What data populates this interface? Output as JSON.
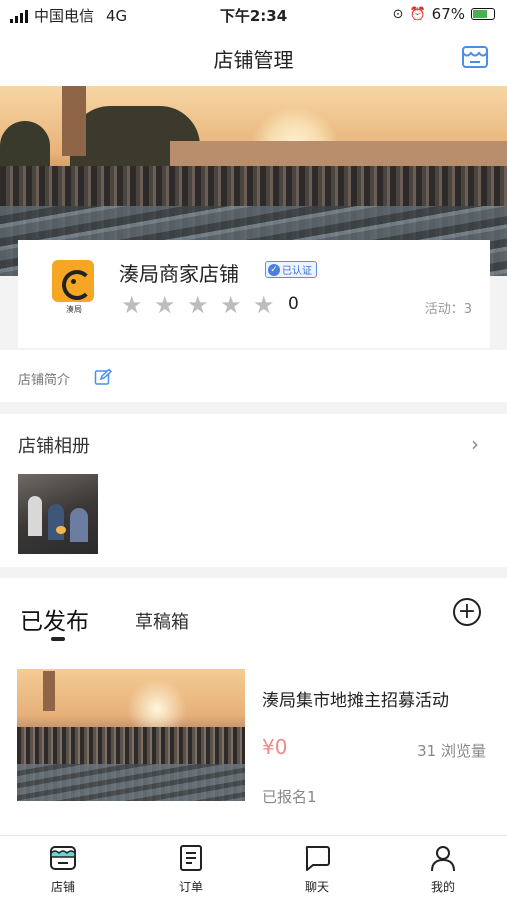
{
  "status_bar": {
    "carrier": "中国电信",
    "network": "4G",
    "time": "下午2:34",
    "battery": "67%"
  },
  "nav": {
    "title": "店铺管理",
    "store_icon": "store-icon"
  },
  "shop": {
    "name": "湊局商家店铺",
    "verified_badge": "已认证",
    "logo_text": "湊局",
    "rating_stars": 0,
    "rating_count": "0",
    "activity": "活动：3"
  },
  "intro": {
    "label": "店铺简介"
  },
  "album": {
    "title": "店铺相册"
  },
  "posts": {
    "tabs": {
      "published": "已发布",
      "drafts": "草稿箱"
    },
    "items": [
      {
        "title": "湊局集市地摊主招募活动",
        "price": "¥0",
        "views": "31 浏览量",
        "signups": "已报名1"
      }
    ]
  },
  "tab_bar": {
    "items": [
      {
        "label": "店铺",
        "icon": "store-icon"
      },
      {
        "label": "订单",
        "icon": "order-icon"
      },
      {
        "label": "聊天",
        "icon": "chat-icon"
      },
      {
        "label": "我的",
        "icon": "user-icon"
      }
    ]
  },
  "colors": {
    "accent_blue": "#4a90e2",
    "price_red": "#f08a8a",
    "logo_orange": "#f5a623"
  }
}
